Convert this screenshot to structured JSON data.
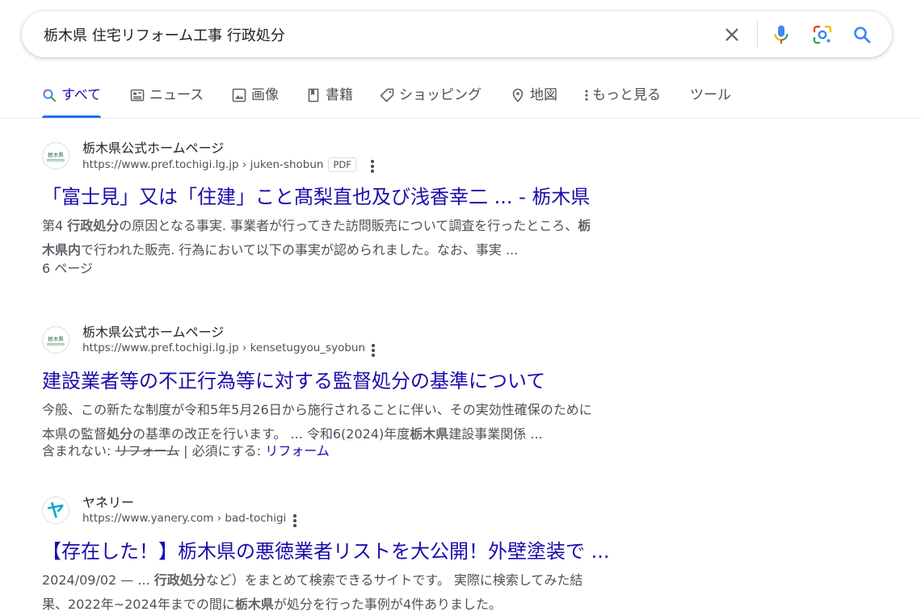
{
  "search": {
    "query": "栃木県 住宅リフォーム工事 行政処分",
    "clear_icon": "close-icon",
    "voice_icon": "mic-icon",
    "lens_icon": "lens-icon",
    "search_icon": "search-icon"
  },
  "tabs": [
    {
      "label": "すべて",
      "icon": "search-icon",
      "active": true
    },
    {
      "label": "ニュース",
      "icon": "news-icon"
    },
    {
      "label": "画像",
      "icon": "image-icon"
    },
    {
      "label": "書籍",
      "icon": "book-icon"
    },
    {
      "label": "ショッピング",
      "icon": "tag-icon"
    },
    {
      "label": "地図",
      "icon": "map-pin-icon"
    },
    {
      "label": "もっと見る",
      "icon": "more-vert-icon"
    },
    {
      "label": "ツール"
    }
  ],
  "results": [
    {
      "site_name": "栃木県公式ホームページ",
      "favicon_text": "栃木県",
      "url": "https://www.pref.tochigi.lg.jp › juken-shobun",
      "badge": "PDF",
      "title": "「富士見」又は「住建」こと髙梨直也及び浅香幸二 ... - 栃木県",
      "snippet": {
        "l1a": "第4 ",
        "l1b": "行政処分",
        "l1c": "の原因となる事実. 事業者が行ってきた訪問販売について調査を行ったところ、",
        "l1d": "栃",
        "l2a": "木県内",
        "l2b": "で行われた販売. 行為において以下の事実が認められました。なお、事実 ..."
      },
      "meta": "6 ページ"
    },
    {
      "site_name": "栃木県公式ホームページ",
      "favicon_text": "栃木県",
      "url": "https://www.pref.tochigi.lg.jp › kensetugyou_syobun",
      "title": "建設業者等の不正行為等に対する監督処分の基準について",
      "snippet": {
        "l1a": "今般、この新たな制度が令和5年5月26日から施行されることに伴い、その実効性確保のために",
        "l2a": "本県の監督",
        "l2b": "処分",
        "l2c": "の基準の改正を行います。 ... 令和6(2024)年度",
        "l2d": "栃木県",
        "l2e": "建設事業関係 ..."
      },
      "missing": {
        "label": "含まれない: ",
        "term": "リフォーム",
        "sep": " | 必須にする: ",
        "link": "リフォーム"
      }
    },
    {
      "site_name": "ヤネリー",
      "favicon_text": "ヤ",
      "url": "https://www.yanery.com › bad-tochigi",
      "title": "【存在した！】栃木県の悪徳業者リストを大公開！外壁塗装で ...",
      "snippet": {
        "l1a": "2024/09/02 — ... ",
        "l1b": "行政処分",
        "l1c": "など）をまとめて検索できるサイトです。 実際に検索してみた結",
        "l2a": "果、2022年~2024年までの間に",
        "l2b": "栃木県",
        "l2c": "が処分を行った事例が4件ありました。"
      }
    }
  ],
  "colors": {
    "link": "#1a0dab",
    "tab_active_bar": "#1a73e8",
    "text_secondary": "#4d5156",
    "yanery_brand": "#0aa7c7"
  }
}
